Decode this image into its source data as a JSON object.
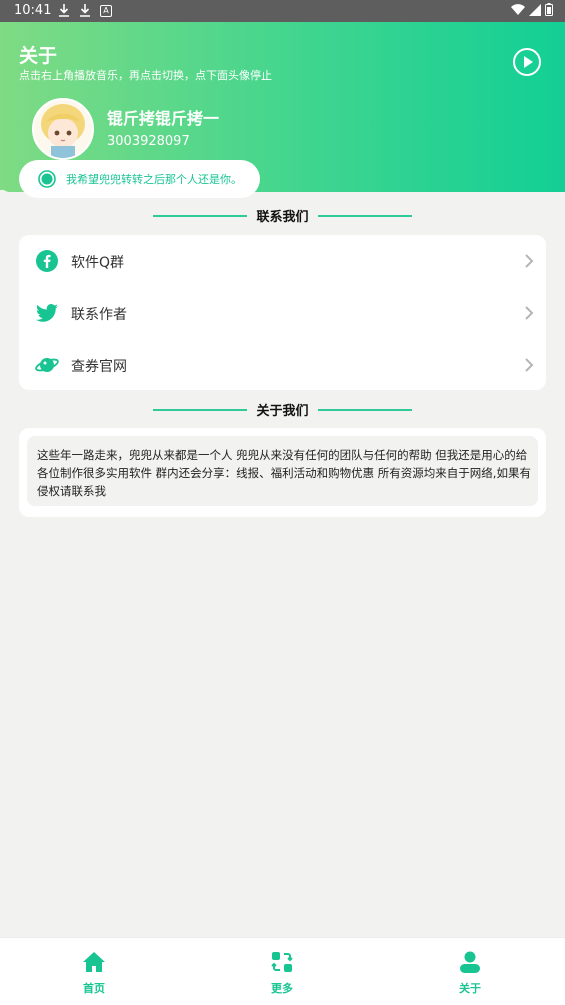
{
  "status_bar": {
    "time": "10:41",
    "a_label": "A"
  },
  "header": {
    "title": "关于",
    "subtitle": "点击右上角播放音乐，再点击切换，点下面头像停止",
    "nickname": "锟斤拷锟斤拷一",
    "qq_number": "3003928097",
    "quote": "我希望兜兜转转之后那个人还是你。"
  },
  "contact_section": {
    "title": "联系我们",
    "items": [
      {
        "label": "软件Q群",
        "icon": "facebook-icon"
      },
      {
        "label": "联系作者",
        "icon": "twitter-icon"
      },
      {
        "label": "查券官网",
        "icon": "planet-icon"
      }
    ]
  },
  "about_section": {
    "title": "关于我们",
    "text": "这些年一路走来，兜兜从来都是一个人 兜兜从来没有任何的团队与任何的帮助 但我还是用心的给各位制作很多实用软件 群内还会分享：线报、福利活动和购物优惠 所有资源均来自于网络,如果有侵权请联系我"
  },
  "bottom_nav": {
    "items": [
      {
        "label": "首页",
        "icon": "home-icon"
      },
      {
        "label": "更多",
        "icon": "swap-icon"
      },
      {
        "label": "关于",
        "icon": "user-icon"
      }
    ]
  },
  "colors": {
    "accent": "#18c592",
    "header_start": "#7fdb84",
    "header_end": "#12cf95",
    "background": "#f2f3f1"
  }
}
